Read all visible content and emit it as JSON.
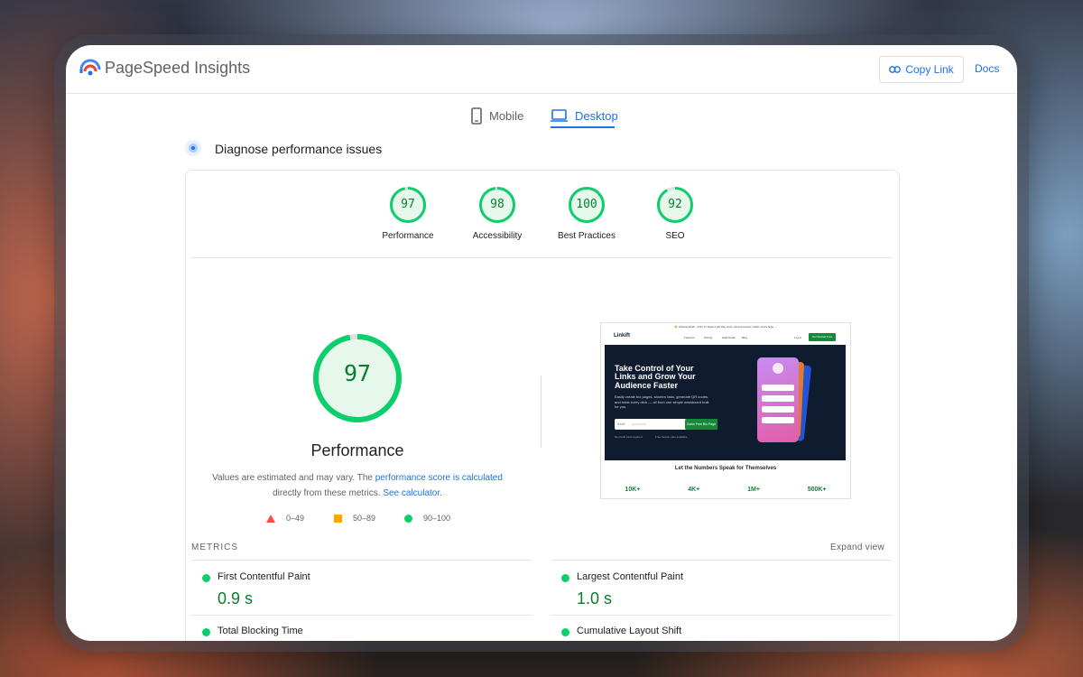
{
  "header": {
    "title": "PageSpeed Insights",
    "copy_link": "Copy Link",
    "docs": "Docs"
  },
  "tabs": [
    {
      "label": "Mobile",
      "icon": "phone-icon"
    },
    {
      "label": "Desktop",
      "icon": "laptop-icon",
      "active": true
    }
  ],
  "diagnose": {
    "title": "Diagnose performance issues"
  },
  "scores": [
    {
      "value": "97",
      "label": "Performance",
      "score": 97
    },
    {
      "value": "98",
      "label": "Accessibility",
      "score": 98
    },
    {
      "value": "100",
      "label": "Best Practices",
      "score": 100
    },
    {
      "value": "92",
      "label": "SEO",
      "score": 92
    }
  ],
  "performance": {
    "score": "97",
    "score_fraction": 0.97,
    "title": "Performance",
    "note_prefix": "Values are estimated and may vary. The ",
    "note_link1": "performance score is calculated",
    "note_middle": "directly from these metrics. ",
    "note_link2": "See calculator."
  },
  "legend": [
    {
      "range": "0–49",
      "shape": "triangle",
      "color": "#ff4e42"
    },
    {
      "range": "50–89",
      "shape": "square",
      "color": "#ffa400"
    },
    {
      "range": "90–100",
      "shape": "circle",
      "color": "#0cce6b"
    }
  ],
  "screenshot": {
    "announcement": "🔥 Lifetime Deal – Only 17 Spots Left! Pay once, access forever. Claim Yours Now →",
    "logo": "Linkift",
    "nav_items": [
      "Features",
      "Pricing",
      "Help/Guide",
      "Blog"
    ],
    "login": "Log in",
    "nav_cta": "Get Started Free",
    "headline": "Take Control of Your Links and Grow Your Audience Faster",
    "paragraph": "Easily create bio pages, shorten links, generate QR codes, and track every click — all from one simple dashboard built for you.",
    "input_prefix": "linkift/",
    "input_placeholder": "yourname",
    "cta": "Claim Free Bio Page",
    "benefit1": "No credit card required",
    "benefit2": "Free forever plan available",
    "section_title": "Let the Numbers Speak for Themselves",
    "stats": [
      "10K+",
      "4K+",
      "1M+",
      "500K+"
    ]
  },
  "metrics": {
    "heading": "METRICS",
    "expand": "Expand view",
    "items": [
      {
        "title": "First Contentful Paint",
        "value": "0.9 s"
      },
      {
        "title": "Largest Contentful Paint",
        "value": "1.0 s"
      },
      {
        "title": "Total Blocking Time",
        "value": ""
      },
      {
        "title": "Cumulative Layout Shift",
        "value": ""
      }
    ]
  },
  "colors": {
    "accent": "#1a73e8",
    "pass": "#0cce6b",
    "pass_text": "#0a7d2c"
  }
}
